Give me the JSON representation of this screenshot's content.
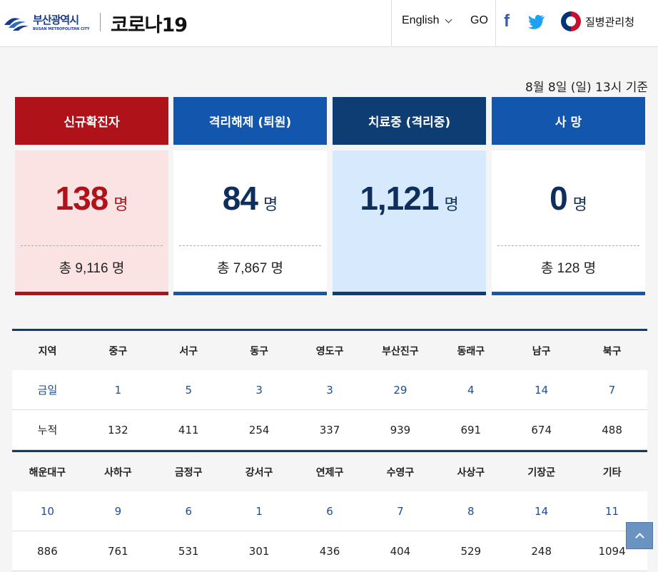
{
  "header": {
    "logo_ko": "부산광역시",
    "logo_en": "BUSAN METROPOLITAN CITY",
    "site_title": "코로나19",
    "language": "English",
    "go_label": "GO",
    "facebook_label": "f",
    "kdca_label": "질병관리청"
  },
  "date_label": "8월 8일 (일)  13시 기준",
  "unit": "명",
  "cards": [
    {
      "title": "신규확진자",
      "value": "138",
      "total": "총 9,116 명",
      "head_color": "#b01219",
      "body_bg": "#fbe3e3",
      "num_color": "#b01219",
      "bar_color": "#b01219"
    },
    {
      "title": "격리해제 (퇴원)",
      "value": "84",
      "total": "총 7,867 명",
      "head_color": "#1256ad",
      "body_bg": "#ffffff",
      "num_color": "#0e2f5e",
      "bar_color": "#1256ad"
    },
    {
      "title": "치료중 (격리중)",
      "value": "1,121",
      "total": "",
      "head_color": "#0e3d73",
      "body_bg": "#d6e9fd",
      "num_color": "#0e2f5e",
      "bar_color": "#0e3d73"
    },
    {
      "title": "사 망",
      "value": "0",
      "total": "총 128 명",
      "head_color": "#1256ad",
      "body_bg": "#ffffff",
      "num_color": "#0e2f5e",
      "bar_color": "#1256ad"
    }
  ],
  "table": {
    "block1": {
      "headers": [
        "지역",
        "중구",
        "서구",
        "동구",
        "영도구",
        "부산진구",
        "동래구",
        "남구",
        "북구"
      ],
      "today": [
        "금일",
        "1",
        "5",
        "3",
        "3",
        "29",
        "4",
        "14",
        "7"
      ],
      "cumulative": [
        "누적",
        "132",
        "411",
        "254",
        "337",
        "939",
        "691",
        "674",
        "488"
      ]
    },
    "block2": {
      "headers": [
        "해운대구",
        "사하구",
        "금정구",
        "강서구",
        "연제구",
        "수영구",
        "사상구",
        "기장군",
        "기타"
      ],
      "today": [
        "10",
        "9",
        "6",
        "1",
        "6",
        "7",
        "8",
        "14",
        "11"
      ],
      "cumulative": [
        "886",
        "761",
        "531",
        "301",
        "436",
        "404",
        "529",
        "248",
        "1094"
      ]
    }
  },
  "icons": {
    "logo": "busan-logo-icon",
    "facebook": "facebook-icon",
    "twitter": "twitter-icon",
    "kdca": "kdca-emblem-icon",
    "top": "scroll-top-icon"
  }
}
